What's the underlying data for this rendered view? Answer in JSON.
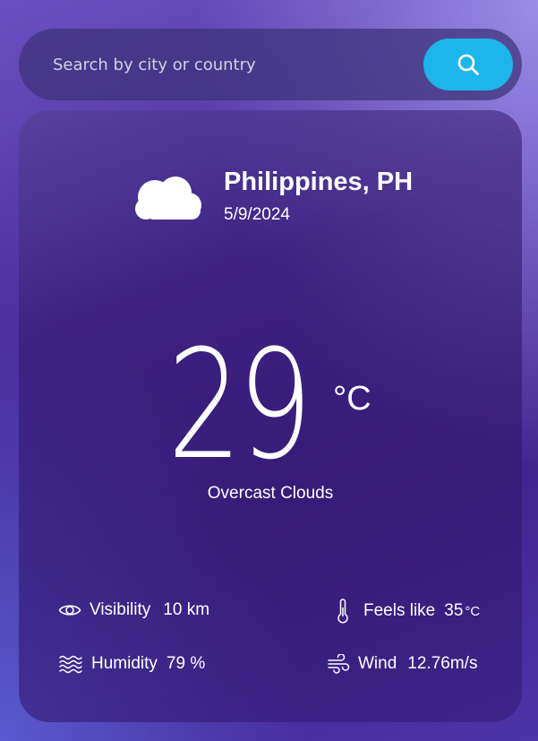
{
  "search": {
    "placeholder": "Search by city or country",
    "value": ""
  },
  "weather": {
    "icon": "cloud-icon",
    "location": "Philippines, PH",
    "date": "5/9/2024",
    "temperature": "29",
    "temperature_unit": "°C",
    "description": "Overcast Clouds"
  },
  "stats": {
    "visibility": {
      "icon": "eye-icon",
      "label": "Visibility",
      "value": "10 km"
    },
    "humidity": {
      "icon": "humidity-waves-icon",
      "label": "Humidity",
      "value": "79 %"
    },
    "feels_like": {
      "icon": "thermometer-icon",
      "label": "Feels like",
      "value": "35",
      "unit": "°C"
    },
    "wind": {
      "icon": "wind-icon",
      "label": "Wind",
      "value": "12.76m/s"
    }
  },
  "colors": {
    "accent": "#1eb6ea",
    "background": "#4a2c9a",
    "text": "#ffffff"
  }
}
